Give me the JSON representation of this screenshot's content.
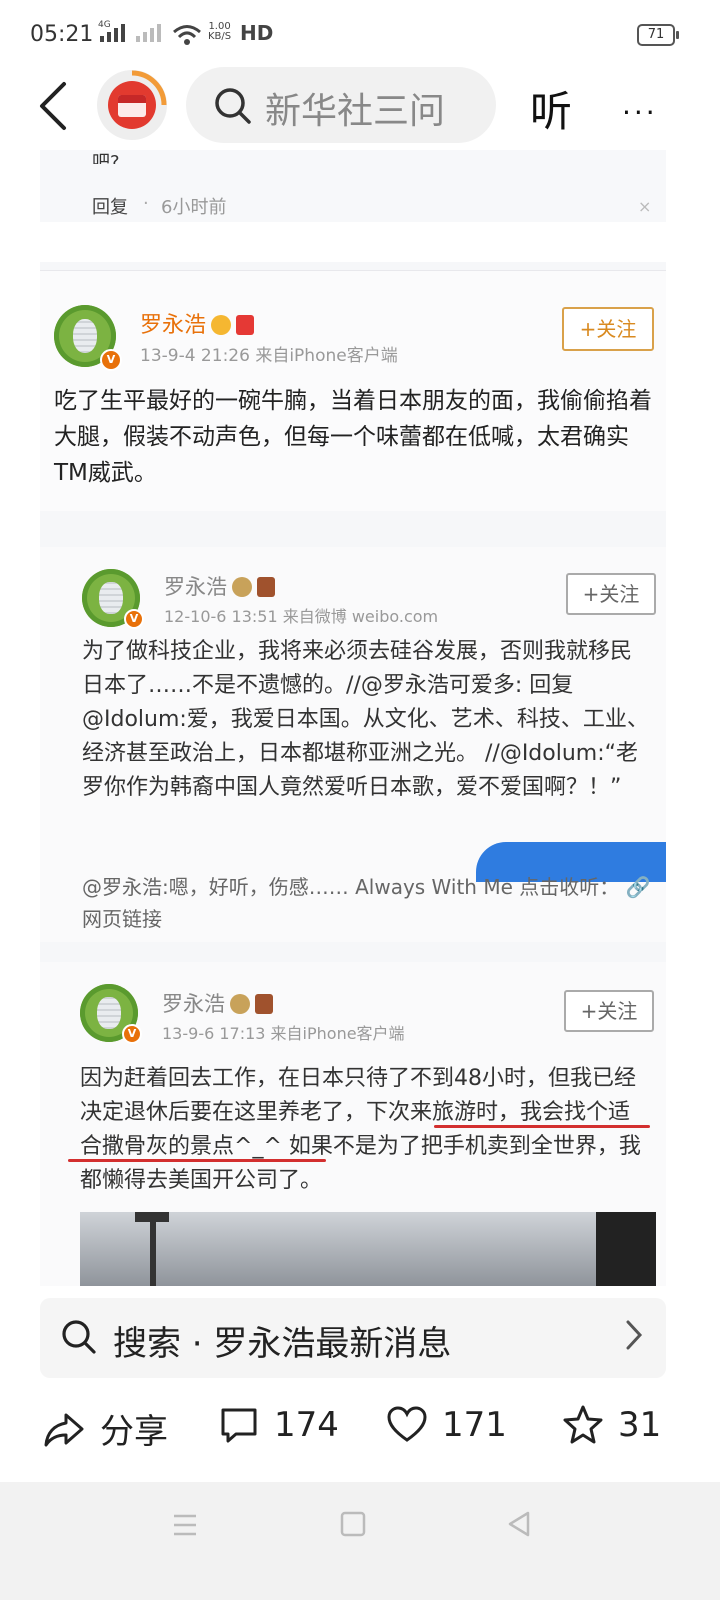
{
  "status_bar": {
    "time": "05:21",
    "network_label": "4G",
    "net_speed_value": "1.00",
    "net_speed_unit": "KB/S",
    "hd_label": "HD",
    "battery": "71"
  },
  "header": {
    "search_query": "新华社三问",
    "listen_label": "听",
    "more_label": "···"
  },
  "comment_card": {
    "clipped_text": "吧?",
    "reply_label": "回复",
    "separator": "·",
    "time_ago": "6小时前",
    "close_label": "×"
  },
  "post_main": {
    "username": "罗永浩",
    "meta": "13-9-4 21:26  来自iPhone客户端",
    "follow_label": "+关注",
    "text": "吃了生平最好的一碗牛腩，当着日本朋友的面，我偷偷掐着大腿，假装不动声色，但每一个味蕾都在低喊，太君确实TM威武。"
  },
  "screenshot_post_1": {
    "username": "罗永浩",
    "meta": "12-10-6 13:51  来自微博 weibo.com",
    "follow_label": "+关注",
    "text": "为了做科技企业，我将来必须去硅谷发展，否则我就移民日本了……不是不遗憾的。//@罗永浩可爱多: 回复@Idolum:爱，我爱日本国。从文化、艺术、科技、工业、经济甚至政治上，日本都堪称亚洲之光。 //@Idolum:“老罗你作为韩裔中国人竟然爱听日本歌，爱不爱国啊？！”",
    "footer": "@罗永浩:嗯，好听，伤感…… Always With Me 点击收听：",
    "link_label": "网页链接"
  },
  "screenshot_post_2": {
    "username": "罗永浩",
    "meta": "13-9-6 17:13  来自iPhone客户端",
    "follow_label": "+关注",
    "text_a": "因为赶着回去工作，在日本只待了不到48小时，但我已经决定退休后要在这里养老了，",
    "text_highlight_1": "下次来旅游时，我会",
    "text_highlight_2": "找个适合撒骨灰的景点",
    "text_b": "^_^ 如果不是为了把手机卖到全世界，我都懒得去美国开公司了。"
  },
  "suggestion": {
    "text": "搜索 · 罗永浩最新消息"
  },
  "actions": {
    "share": "分享",
    "comments": "174",
    "likes": "171",
    "favorites": "31"
  },
  "colors": {
    "accent_orange": "#e8710a",
    "underline_red": "#d32f2f",
    "badge_red": "#e23a2f"
  }
}
